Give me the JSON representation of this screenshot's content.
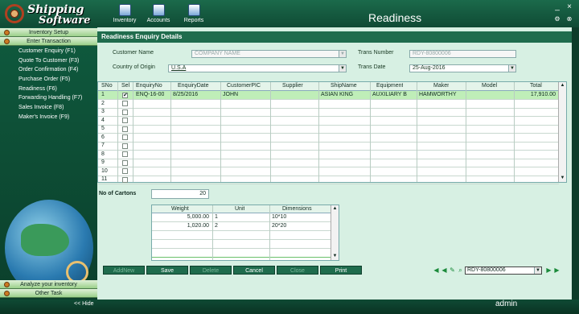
{
  "app": {
    "logo_line1": "Shipping",
    "logo_line2": "Software",
    "window_title": "Readiness",
    "user": "admin"
  },
  "toolbar": {
    "items": [
      {
        "label": "Inventory",
        "icon": "inventory-icon"
      },
      {
        "label": "Accounts",
        "icon": "accounts-icon"
      },
      {
        "label": "Reports",
        "icon": "reports-icon"
      }
    ]
  },
  "window_controls": {
    "minimize": "_",
    "close": "×"
  },
  "sidebar": {
    "inventory_setup": "Inventory Setup",
    "enter_transaction": "Enter Transaction",
    "items": [
      {
        "label": "Customer Enquiry (F1)"
      },
      {
        "label": "Quote To Customer (F3)"
      },
      {
        "label": "Order Confirmation (F4)"
      },
      {
        "label": "Purchase Order (F5)"
      },
      {
        "label": "Readiness (F6)"
      },
      {
        "label": "Forwarding Handling (F7)"
      },
      {
        "label": "Sales Invoice (F8)"
      },
      {
        "label": "Maker's Invoice (F9)"
      }
    ],
    "analyze_inventory": "Analyze your inventory",
    "other_task": "Other Task",
    "hide": "<< Hide"
  },
  "form": {
    "section_title": "Readiness Enquiry Details",
    "customer_name_label": "Customer Name",
    "customer_name_value": "COMPANY NAME",
    "trans_number_label": "Trans Number",
    "trans_number_value": "RDY-80800006",
    "country_label": "Country of Origin",
    "country_value": "U.S.A",
    "trans_date_label": "Trans Date",
    "trans_date_value": "25-Aug-2016"
  },
  "grid": {
    "columns": [
      "SNo",
      "Sel",
      "EnquiryNo",
      "EnquiryDate",
      "CustomerPIC",
      "Supplier",
      "ShipName",
      "Equipment",
      "Maker",
      "Model",
      "Total"
    ],
    "rows": [
      {
        "sno": "1",
        "sel": "✔",
        "enquiry_no": "ENQ-16-00",
        "enquiry_date": "8/25/2016",
        "customer_pic": "JOHN",
        "supplier": "",
        "ship_name": "ASIAN KING",
        "equipment": "AUXILIARY B",
        "maker": "HAMWORTHY",
        "model": "",
        "total": "17,910.00"
      },
      {
        "sno": "2"
      },
      {
        "sno": "3"
      },
      {
        "sno": "4"
      },
      {
        "sno": "5"
      },
      {
        "sno": "6"
      },
      {
        "sno": "7"
      },
      {
        "sno": "8"
      },
      {
        "sno": "9"
      },
      {
        "sno": "10"
      },
      {
        "sno": "11"
      }
    ]
  },
  "cartons": {
    "label": "No of Cartons",
    "value": "20"
  },
  "subgrid": {
    "columns": [
      "Weight",
      "Unit",
      "Dimensions"
    ],
    "rows": [
      {
        "weight": "5,000.00",
        "unit": "1",
        "dimensions": "10*10"
      },
      {
        "weight": "1,020.00",
        "unit": "2",
        "dimensions": "20*20"
      }
    ]
  },
  "buttons": {
    "add_new": "AddNew",
    "save": "Save",
    "delete": "Delete",
    "cancel": "Cancel",
    "close": "Close",
    "print": "Print"
  },
  "navigator": {
    "value": "RDY-80800006"
  },
  "colors": {
    "accent": "#1f6c4d",
    "selected_row": "#bfeeb8",
    "panel": "#d7f0e3"
  }
}
